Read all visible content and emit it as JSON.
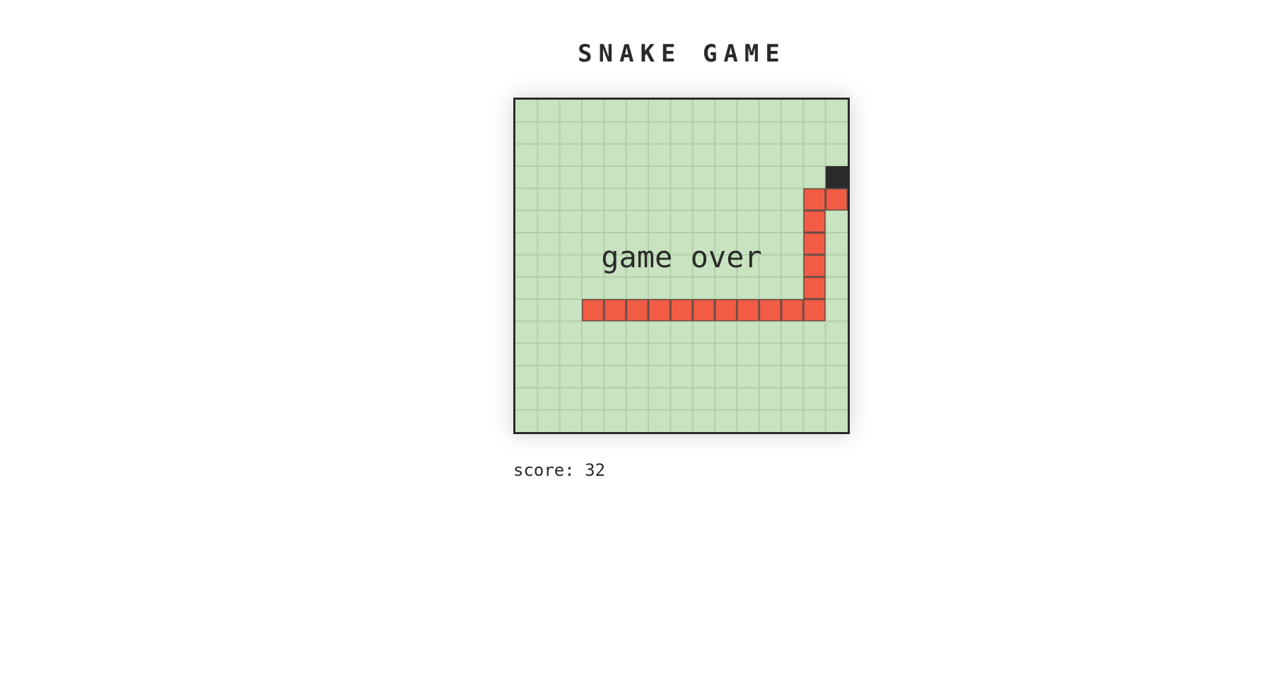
{
  "title": "SNAKE GAME",
  "board": {
    "cols": 15,
    "rows": 15,
    "colors": {
      "background": "#c8e3c0",
      "grid_line": "#b2cea8",
      "snake_fill": "#f25c45",
      "snake_stroke": "#6b4a42",
      "food": "#2b2b2b",
      "border": "#2b2b2b"
    },
    "snake": [
      [
        14,
        4
      ],
      [
        13,
        4
      ],
      [
        13,
        5
      ],
      [
        13,
        6
      ],
      [
        13,
        7
      ],
      [
        13,
        8
      ],
      [
        13,
        9
      ],
      [
        12,
        9
      ],
      [
        11,
        9
      ],
      [
        10,
        9
      ],
      [
        9,
        9
      ],
      [
        8,
        9
      ],
      [
        7,
        9
      ],
      [
        6,
        9
      ],
      [
        5,
        9
      ],
      [
        4,
        9
      ],
      [
        3,
        9
      ]
    ],
    "food": [
      14,
      3
    ],
    "status": "game over"
  },
  "score": {
    "label": "score:",
    "value": "32"
  }
}
